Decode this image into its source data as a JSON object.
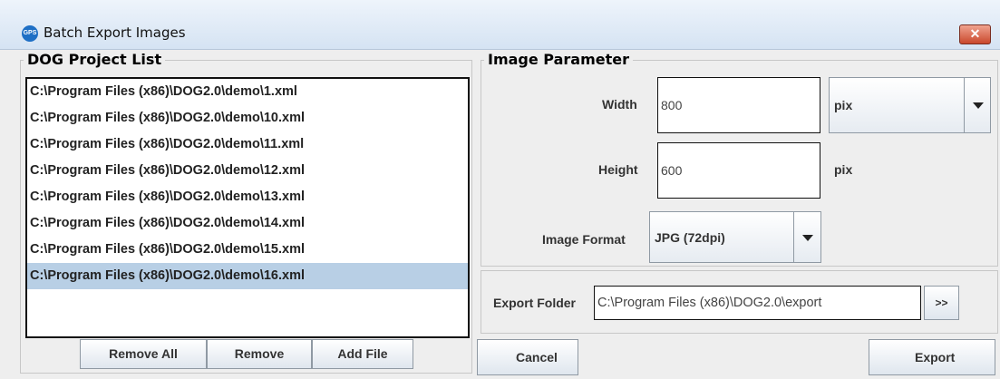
{
  "window": {
    "title": "Batch Export Images",
    "app_icon_text": "GPS",
    "close_label": "✕"
  },
  "project_list": {
    "legend": "DOG Project List",
    "items": [
      "C:\\Program Files (x86)\\DOG2.0\\demo\\1.xml",
      "C:\\Program Files (x86)\\DOG2.0\\demo\\10.xml",
      "C:\\Program Files (x86)\\DOG2.0\\demo\\11.xml",
      "C:\\Program Files (x86)\\DOG2.0\\demo\\12.xml",
      "C:\\Program Files (x86)\\DOG2.0\\demo\\13.xml",
      "C:\\Program Files (x86)\\DOG2.0\\demo\\14.xml",
      "C:\\Program Files (x86)\\DOG2.0\\demo\\15.xml",
      "C:\\Program Files (x86)\\DOG2.0\\demo\\16.xml"
    ],
    "selected_index": 7,
    "remove_all_label": "Remove All",
    "remove_label": "Remove",
    "add_file_label": "Add File"
  },
  "image_parameter": {
    "legend": "Image Parameter",
    "width_label": "Width",
    "width_value": "800",
    "width_unit": "pix",
    "height_label": "Height",
    "height_value": "600",
    "height_unit": "pix",
    "format_label": "Image Format",
    "format_value": "JPG (72dpi)"
  },
  "export": {
    "folder_label": "Export Folder",
    "folder_value": "C:\\Program Files (x86)\\DOG2.0\\export",
    "browse_label": ">>",
    "cancel_label": "Cancel",
    "export_label": "Export"
  },
  "colors": {
    "selection": "#b8cfe5",
    "close_button": "#c9482c",
    "app_icon": "#1e6fc5"
  }
}
